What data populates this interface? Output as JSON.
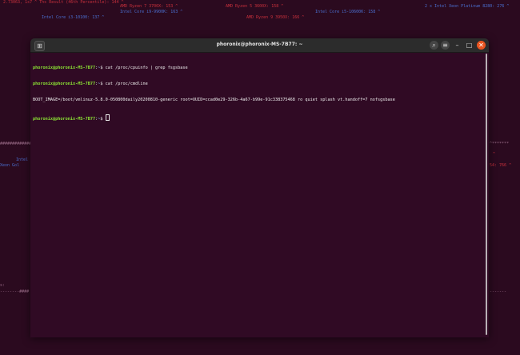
{
  "background": {
    "fragments": [
      {
        "text": "2.73063, 1s7 ^    Ths Result (46th Percentile): 144 ^",
        "color": "red"
      },
      {
        "text": "AMD Ryzen 7 3700X: 153 ^",
        "color": "red"
      },
      {
        "text": "AMD Ryzen 5 3600X: 158 ^",
        "color": "red"
      },
      {
        "text": "Intel Core i3-10100: 137 ^",
        "color": "blue"
      },
      {
        "text": "Intel Core i9-9900K: 163 ^",
        "color": "blue"
      },
      {
        "text": "AMD Ryzen 9 3950X: 166 ^",
        "color": "red"
      },
      {
        "text": "Intel Core i5-10600K: 158 ^",
        "color": "blue"
      },
      {
        "text": "2 x Intel Xeon Platinum 8280: 276 ^",
        "color": "blue"
      },
      {
        "text": "################",
        "color": "dash"
      },
      {
        "text": "Intel",
        "color": "blue"
      },
      {
        "text": "Xeon Gol",
        "color": "blue"
      },
      {
        "text": "^*******",
        "color": "dash"
      },
      {
        "text": "^",
        "color": "red"
      },
      {
        "text": "54: 766 ^",
        "color": "red"
      },
      {
        "text": "s:",
        "color": "dash"
      },
      {
        "text": "--------####",
        "color": "dash"
      },
      {
        "text": "-------",
        "color": "dash"
      }
    ]
  },
  "window": {
    "title": "phoronix@phoronix-MS-7B77: ~",
    "icons": {
      "new_tab": "new-tab-icon",
      "search": "search-icon",
      "menu": "hamburger-menu-icon",
      "minimize": "minimize-icon",
      "maximize": "maximize-icon",
      "close": "close-icon"
    },
    "glyphs": {
      "new_tab": "⊞",
      "search": "⌕",
      "menu": "≡",
      "minimize": "–",
      "maximize": "□",
      "close": "✕"
    }
  },
  "terminal": {
    "lines": [
      {
        "user": "phoronix@phoronix-MS-7B77",
        "sep": ":",
        "path": "~",
        "symbol": "$ ",
        "command": "cat /proc/cpuinfo | grep fsgsbase"
      },
      {
        "user": "phoronix@phoronix-MS-7B77",
        "sep": ":",
        "path": "~",
        "symbol": "$ ",
        "command": "cat /proc/cmdline"
      },
      {
        "output": "BOOT_IMAGE=/boot/vmlinuz-5.8.0-050800daily20200810-generic root=UUID=ccad0e29-326b-4a67-b99e-91c338375468 ro quiet splash vt.handoff=7 nofsgsbase"
      },
      {
        "user": "phoronix@phoronix-MS-7B77",
        "sep": ":",
        "path": "~",
        "symbol": "$ ",
        "command": "",
        "cursor": true
      }
    ]
  }
}
